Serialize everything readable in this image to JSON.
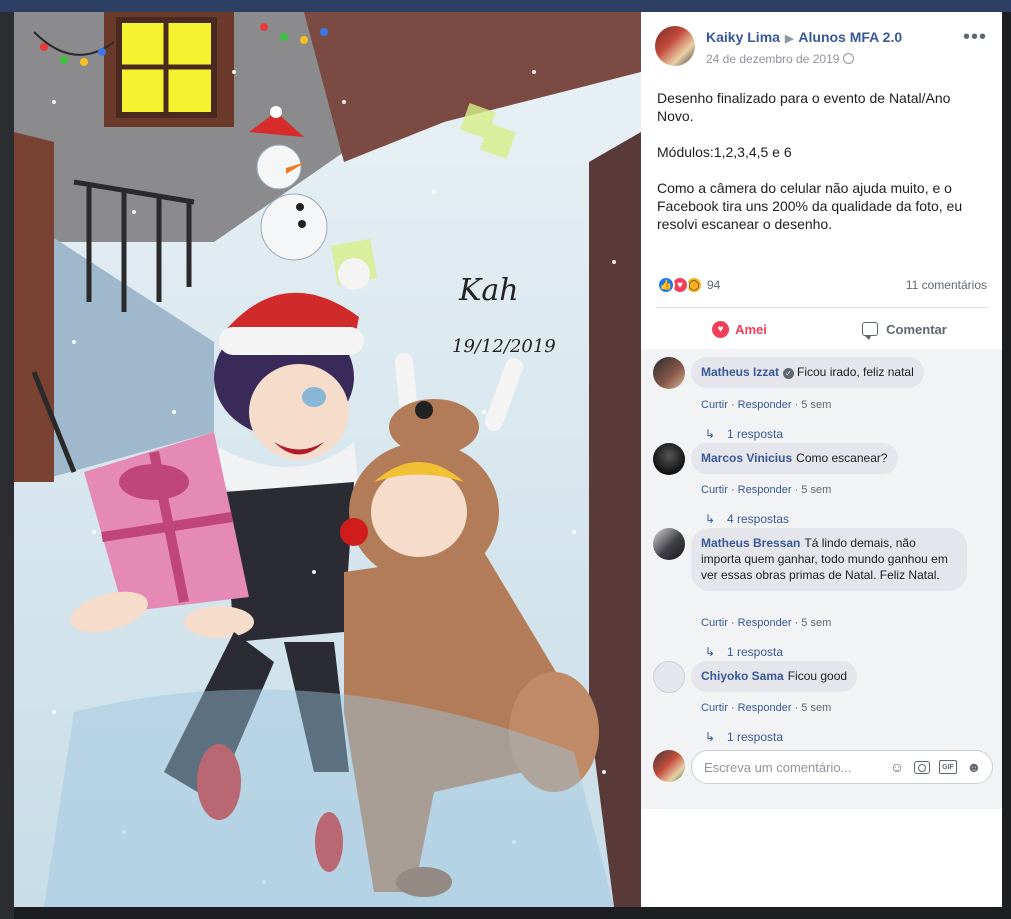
{
  "post": {
    "author": "Kaiky Lima",
    "group": "Alunos MFA 2.0",
    "date": "24 de dezembro de 2019",
    "text": "Desenho finalizado para o evento de Natal/Ano Novo.\n\nMódulos:1,2,3,4,5 e 6\n\nComo a câmera do celular não ajuda muito, e o Facebook tira uns 200% da qualidade da foto, eu resolvi escanear o desenho.",
    "reaction_count": "94",
    "comment_count": "11 comentários"
  },
  "artwork": {
    "signature": "Kah",
    "signature_date": "19/12/2019"
  },
  "actions": {
    "love_label": "Amei",
    "comment_label": "Comentar"
  },
  "comments": [
    {
      "name": "Matheus Izzat",
      "text": "Ficou irado, feliz natal",
      "verified": true,
      "avatar_color": "#6b4a3a",
      "replies": "1 resposta"
    },
    {
      "name": "Marcos Vinicius",
      "text": "Como escanear?",
      "verified": false,
      "avatar_color": "#1b1b1b",
      "replies": "4 respostas"
    },
    {
      "name": "Matheus Bressan",
      "text": "Tá lindo demais, não importa quem ganhar, todo mundo ganhou em ver essas obras primas de Natal. Feliz Natal.",
      "verified": false,
      "avatar_color": "#3f3f46",
      "replies": "1 resposta"
    },
    {
      "name": "Chiyoko Sama",
      "text": "Ficou good",
      "verified": false,
      "avatar_color": "#e4e6eb",
      "replies": "1 resposta"
    }
  ],
  "comment_meta": {
    "like": "Curtir",
    "reply": "Responder",
    "sep": " · ",
    "time": "5 sem"
  },
  "composer": {
    "placeholder": "Escreva um comentário..."
  },
  "colors": {
    "link": "#385898",
    "love": "#f33e58",
    "like": "#1877f2",
    "wow": "#f7b125"
  },
  "icons": [
    "like-icon",
    "love-icon",
    "wow-icon",
    "globe-icon",
    "more-icon",
    "comment-icon",
    "reply-arrow-icon",
    "emoji-icon",
    "camera-icon",
    "gif-icon",
    "sticker-icon"
  ]
}
